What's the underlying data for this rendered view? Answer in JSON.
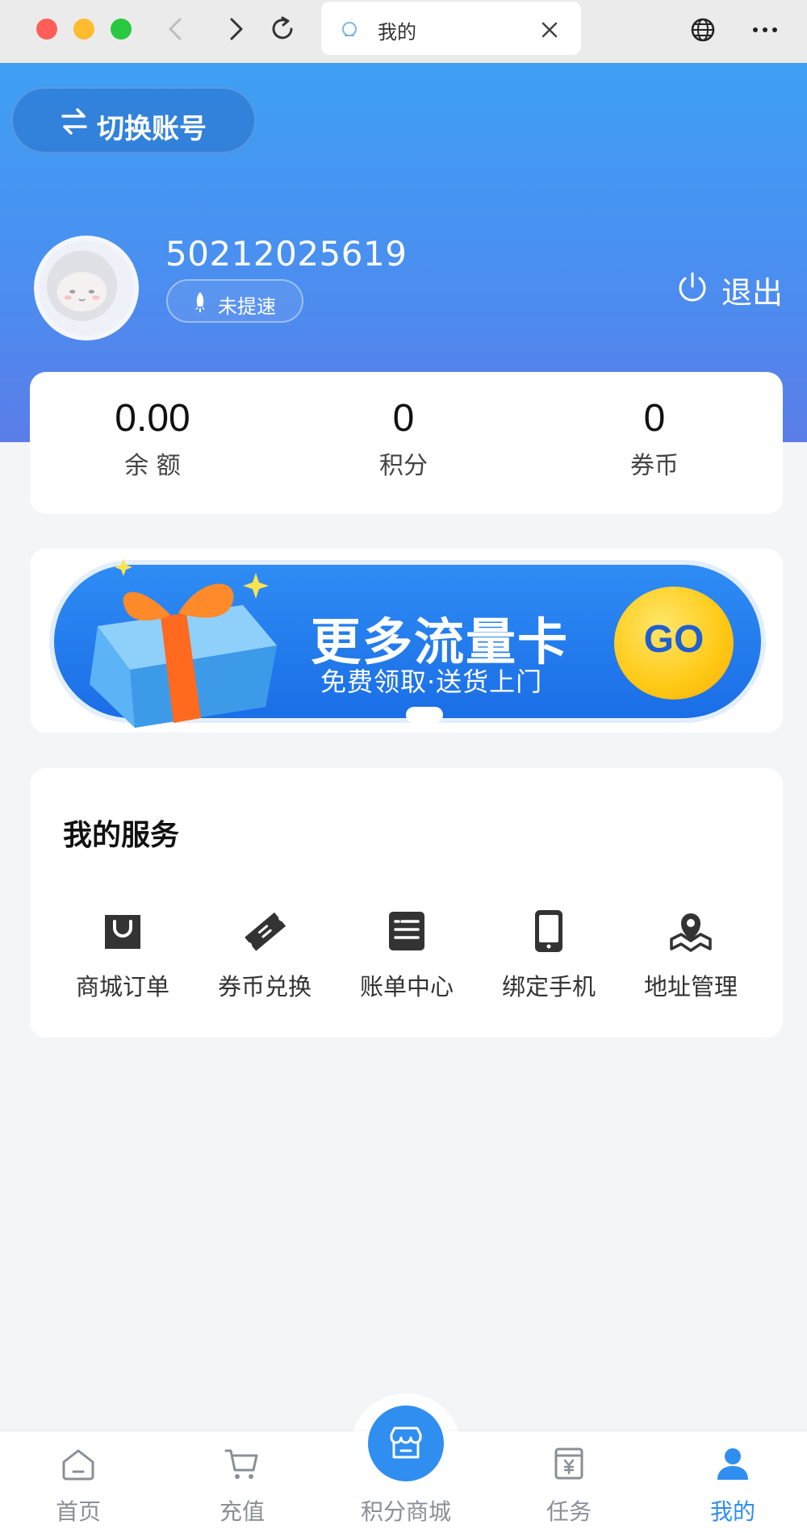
{
  "browser": {
    "tab_title": "我的"
  },
  "header": {
    "switch_account_label": "切换账号",
    "user_id": "50212025619",
    "speed_status": "未提速",
    "logout_label": "退出"
  },
  "stats": [
    {
      "value": "0.00",
      "label": "余 额"
    },
    {
      "value": "0",
      "label": "积分"
    },
    {
      "value": "0",
      "label": "券币"
    }
  ],
  "banner": {
    "title": "更多流量卡",
    "subtitle": "免费领取·送货上门",
    "go_label": "GO"
  },
  "services": {
    "title": "我的服务",
    "items": [
      {
        "label": "商城订单",
        "icon": "shopping-bag-icon"
      },
      {
        "label": "券币兑换",
        "icon": "ticket-icon"
      },
      {
        "label": "账单中心",
        "icon": "bill-icon"
      },
      {
        "label": "绑定手机",
        "icon": "phone-icon"
      },
      {
        "label": "地址管理",
        "icon": "map-pin-icon"
      }
    ]
  },
  "tabbar": {
    "items": [
      {
        "label": "首页",
        "icon": "home-icon"
      },
      {
        "label": "充值",
        "icon": "cart-icon"
      },
      {
        "label": "积分商城",
        "icon": "store-icon"
      },
      {
        "label": "任务",
        "icon": "task-icon"
      },
      {
        "label": "我的",
        "icon": "user-icon"
      }
    ],
    "active_index": 4
  },
  "colors": {
    "accent": "#2f8ef0",
    "header_top": "#3f9ff4",
    "header_bottom": "#5b7de8",
    "go_button": "#ffc915"
  }
}
